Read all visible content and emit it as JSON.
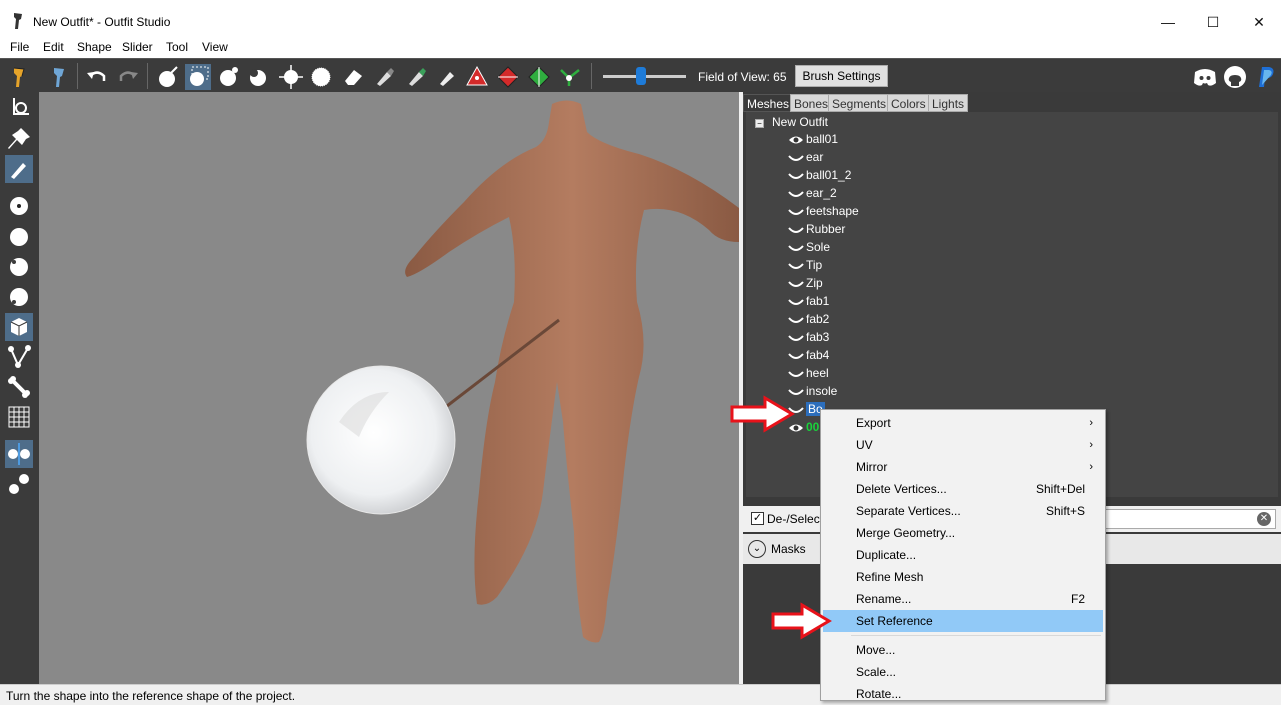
{
  "window": {
    "title": "New Outfit* - Outfit Studio",
    "controls": {
      "minimize": "—",
      "maximize": "☐",
      "close": "✕"
    }
  },
  "menubar": [
    "File",
    "Edit",
    "Shape",
    "Slider",
    "Tool",
    "View"
  ],
  "toolbar": {
    "fov_label": "Field of View: 65",
    "fov_value": 65,
    "brush_settings": "Brush Settings"
  },
  "tabs": [
    "Meshes",
    "Bones",
    "Segments",
    "Colors",
    "Lights"
  ],
  "tree": {
    "root": "New Outfit",
    "items": [
      "ball01",
      "ear",
      "ball01_2",
      "ear_2",
      "feetshape",
      "Rubber",
      "Sole",
      "Tip",
      "Zip",
      "fab1",
      "fab2",
      "fab3",
      "fab4",
      "heel",
      "insole",
      "Bo",
      "00"
    ]
  },
  "lower": {
    "deselect_label": "De-/Select",
    "masks_label": "Masks"
  },
  "context_menu": {
    "items": [
      {
        "label": "Export",
        "shortcut": "",
        "submenu": true
      },
      {
        "label": "UV",
        "shortcut": "",
        "submenu": true
      },
      {
        "label": "Mirror",
        "shortcut": "",
        "submenu": true
      },
      {
        "label": "Delete Vertices...",
        "shortcut": "Shift+Del",
        "submenu": false
      },
      {
        "label": "Separate Vertices...",
        "shortcut": "Shift+S",
        "submenu": false
      },
      {
        "label": "Merge Geometry...",
        "shortcut": "",
        "submenu": false
      },
      {
        "label": "Duplicate...",
        "shortcut": "",
        "submenu": false
      },
      {
        "label": "Refine Mesh",
        "shortcut": "",
        "submenu": false
      },
      {
        "label": "Rename...",
        "shortcut": "F2",
        "submenu": false
      },
      {
        "label": "Set Reference",
        "shortcut": "",
        "submenu": false
      },
      {
        "label": "Move...",
        "shortcut": "",
        "submenu": false
      },
      {
        "label": "Scale...",
        "shortcut": "",
        "submenu": false
      },
      {
        "label": "Rotate...",
        "shortcut": "",
        "submenu": false
      }
    ],
    "highlighted": "Set Reference"
  },
  "statusbar": {
    "text": "Turn the shape into the reference shape of the project."
  },
  "colors": {
    "toolbar_bg": "#3b3b3b",
    "viewport_bg": "#898989",
    "accent": "#2c6ebd",
    "highlight": "#91c9f7",
    "annotation_red": "#e8121a"
  }
}
